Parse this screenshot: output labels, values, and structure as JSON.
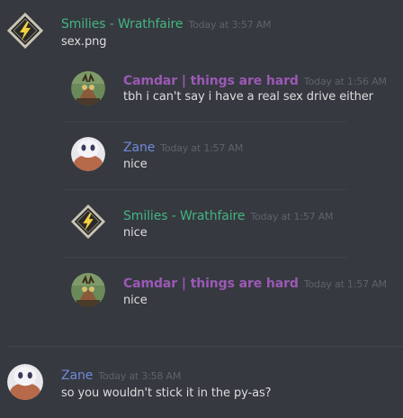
{
  "colors": {
    "background": "#36393f",
    "text": "#dcddde",
    "timestamp": "#5f6368",
    "green": "#43b581",
    "purple": "#9b59b6",
    "blue": "#3498db"
  },
  "messages": [
    {
      "author": "Smilies - Wrathfaire",
      "timestamp": "Today at 3:57 AM",
      "text": "sex.png",
      "avatar_icon": "lightning-badge-icon"
    },
    {
      "author": "Zane",
      "timestamp": "Today at 3:58 AM",
      "text": "so you wouldn't stick it in the py-as?",
      "avatar_icon": "ghost-avatar-icon"
    }
  ],
  "embedded": [
    {
      "author": "Camdar | things are hard",
      "timestamp": "Today at 1:56 AM",
      "text": "tbh i can't say i have a real sex drive either",
      "avatar_icon": "creature-avatar-icon"
    },
    {
      "author": "Zane",
      "timestamp": "Today at 1:57 AM",
      "text": "nice",
      "avatar_icon": "ghost-avatar-icon"
    },
    {
      "author": "Smilies - Wrathfaire",
      "timestamp": "Today at 1:57 AM",
      "text": "nice",
      "avatar_icon": "lightning-badge-icon"
    },
    {
      "author": "Camdar | things are hard",
      "timestamp": "Today at 1:57 AM",
      "text": "nice",
      "avatar_icon": "creature-avatar-icon"
    }
  ]
}
